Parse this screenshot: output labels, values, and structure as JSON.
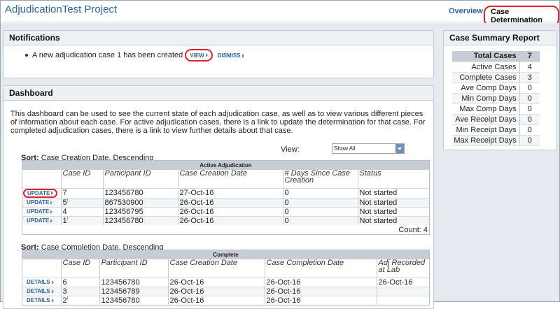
{
  "header": {
    "project_title": "AdjudicationTest Project",
    "tabs": [
      {
        "label": "Overview"
      },
      {
        "label": "Case Determination"
      }
    ]
  },
  "notifications": {
    "title": "Notifications",
    "message": "A new adjudication case 1 has been created",
    "view_label": "VIEW",
    "dismiss_label": "DISMISS"
  },
  "dashboard": {
    "title": "Dashboard",
    "description": "This dashboard can be used to see the current state of each adjudication case, as well as to view various different pieces of information about each case. For active adjudication cases, there is a link to update the determination for that case. For completed adjudication cases, there is a link to view further details about that case.",
    "view_label": "View:",
    "view_value": "Show All",
    "active": {
      "sort_label": "Sort:",
      "sort_value": "Case Creation Date, Descending",
      "title": "Active Adjudication",
      "columns": [
        "Case ID",
        "Participant ID",
        "Case Creation Date",
        "# Days Since Case Creation",
        "Status"
      ],
      "action_label": "UPDATE",
      "rows": [
        {
          "case_id": "7",
          "participant": "123456780",
          "created": "27-Oct-16",
          "days": "0",
          "status": "Not started"
        },
        {
          "case_id": "5",
          "participant": "867530900",
          "created": "26-Oct-16",
          "days": "0",
          "status": "Not started"
        },
        {
          "case_id": "4",
          "participant": "123456795",
          "created": "26-Oct-16",
          "days": "0",
          "status": "Not started"
        },
        {
          "case_id": "1",
          "participant": "123456780",
          "created": "26-Oct-16",
          "days": "0",
          "status": "Not started"
        }
      ],
      "count_label": "Count: 4"
    },
    "complete": {
      "sort_label": "Sort:",
      "sort_value": "Case Completion Date, Descending",
      "title": "Complete",
      "columns": [
        "Case ID",
        "Participant ID",
        "Case Creation Date",
        "Case Completion Date",
        "Adj Recorded at Lab"
      ],
      "action_label": "DETAILS",
      "rows": [
        {
          "case_id": "6",
          "participant": "123456780",
          "created": "26-Oct-16",
          "completed": "26-Oct-16",
          "recorded": "26-Oct-16"
        },
        {
          "case_id": "3",
          "participant": "123456789",
          "created": "26-Oct-16",
          "completed": "26-Oct-16",
          "recorded": ""
        },
        {
          "case_id": "2",
          "participant": "123456780",
          "created": "26-Oct-16",
          "completed": "26-Oct-16",
          "recorded": ""
        }
      ]
    }
  },
  "summary": {
    "title": "Case Summary Report",
    "rows": [
      {
        "label": "Total Cases",
        "value": "7"
      },
      {
        "label": "Active Cases",
        "value": "4"
      },
      {
        "label": "Complete Cases",
        "value": "3"
      },
      {
        "label": "Ave Comp Days",
        "value": "0"
      },
      {
        "label": "Min Comp Days",
        "value": "0"
      },
      {
        "label": "Max Comp Days",
        "value": "0"
      },
      {
        "label": "Ave Receipt Days",
        "value": "0"
      },
      {
        "label": "Min Receipt Days",
        "value": "0"
      },
      {
        "label": "Max Receipt Days",
        "value": "0"
      }
    ]
  }
}
